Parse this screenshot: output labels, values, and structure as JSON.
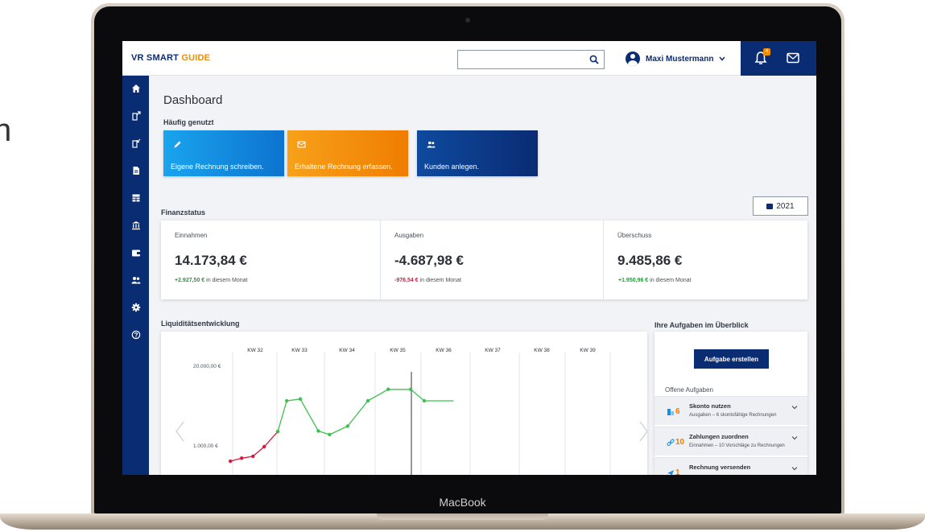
{
  "stray_text": "n",
  "laptop": {
    "brand": "MacBook"
  },
  "app": {
    "logo_main": "VR SMART",
    "logo_accent": "GUIDE",
    "search": {
      "value": "",
      "placeholder": ""
    },
    "user_name": "Maxi Mustermann",
    "notification_count": "4"
  },
  "sidebar": {
    "items": [
      {
        "icon": "home-icon"
      },
      {
        "icon": "outgoing-invoice-icon"
      },
      {
        "icon": "incoming-invoice-icon"
      },
      {
        "icon": "document-icon"
      },
      {
        "icon": "table-icon"
      },
      {
        "icon": "bank-icon"
      },
      {
        "icon": "wallet-icon"
      },
      {
        "icon": "customers-icon"
      },
      {
        "icon": "gear-icon"
      },
      {
        "icon": "help-icon"
      }
    ]
  },
  "dashboard": {
    "title": "Dashboard",
    "frequently_used_label": "Häufig genutzt",
    "quick_actions": [
      {
        "label": "Eigene Rechnung schreiben.",
        "icon": "pencil-icon"
      },
      {
        "label": "Erhaltene Rechnung erfassen.",
        "icon": "mail-icon"
      },
      {
        "label": "Kunden anlegen.",
        "icon": "people-icon"
      }
    ],
    "financial_status_label": "Finanzstatus",
    "year": "2021",
    "finance_cards": [
      {
        "label": "Einnahmen",
        "value": "14.173,84 €",
        "delta": "+2.927,50 €",
        "delta_suffix": "in diesem Monat",
        "delta_color": "#1f9e3a"
      },
      {
        "label": "Ausgaben",
        "value": "-4.687,98 €",
        "delta": "-976,54 €",
        "delta_suffix": "in diesem Monat",
        "delta_color": "#d71a3a"
      },
      {
        "label": "Überschuss",
        "value": "9.485,86 €",
        "delta": "+1.950,96 €",
        "delta_suffix": "in diesem Monat",
        "delta_color": "#1f9e3a"
      }
    ],
    "liquidity_label": "Liquiditätsentwicklung",
    "tasks_label": "Ihre Aufgaben im Überblick",
    "create_task_label": "Aufgabe erstellen",
    "open_tasks_label": "Offene Aufgaben",
    "tasks": [
      {
        "title": "Skonto nutzen",
        "count": "6",
        "desc": "Ausgaben – 6 skontofähige Rechnungen",
        "icon": "invoice-icon"
      },
      {
        "title": "Zahlungen zuordnen",
        "count": "10",
        "desc": "Einnahmen – 10 Vorschläge zu Rechnungen",
        "icon": "link-icon"
      },
      {
        "title": "Rechnung versenden",
        "count": "1",
        "desc": "",
        "icon": "send-icon"
      }
    ]
  },
  "chart_data": {
    "type": "line",
    "categories": [
      "KW 32",
      "KW 33",
      "KW 34",
      "KW 35",
      "KW 36",
      "KW 37",
      "KW 38",
      "KW 39"
    ],
    "y_tick_labels": [
      "20.000,00 €",
      "1.000,00 €"
    ],
    "current_marker": "KW 35",
    "series": [
      {
        "color": "#d71a3a",
        "points": [
          [
            -0.55,
            0.2
          ],
          [
            -0.3,
            0.25
          ],
          [
            -0.05,
            0.28
          ],
          [
            0.2,
            0.44
          ],
          [
            0.5,
            0.69
          ]
        ]
      },
      {
        "color": "#3fbf52",
        "points": [
          [
            0.5,
            0.69
          ],
          [
            0.7,
            1.2
          ],
          [
            1.0,
            1.23
          ],
          [
            1.4,
            0.7
          ],
          [
            1.65,
            0.64
          ],
          [
            2.05,
            0.78
          ],
          [
            2.5,
            1.2
          ],
          [
            2.95,
            1.39
          ],
          [
            3.45,
            1.39
          ],
          [
            3.75,
            1.2
          ],
          [
            4.4,
            1.2
          ]
        ]
      }
    ],
    "colors": {
      "past": "#d71a3a",
      "forecast": "#3fbf52"
    }
  }
}
